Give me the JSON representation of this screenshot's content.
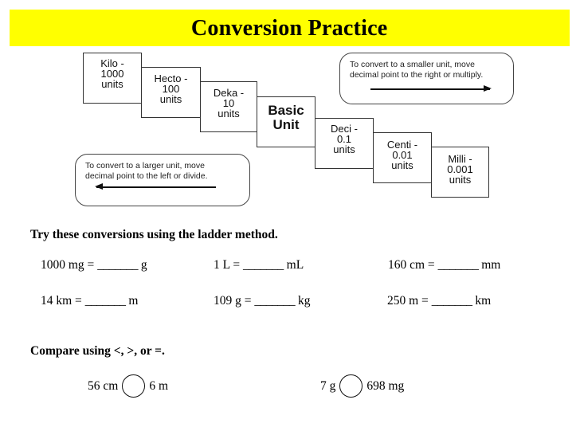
{
  "title": "Conversion Practice",
  "ladder": [
    {
      "prefix": "Kilo -",
      "value": "1000",
      "unit": "units"
    },
    {
      "prefix": "Hecto -",
      "value": "100",
      "unit": "units"
    },
    {
      "prefix": "Deka -",
      "value": "10",
      "unit": "units"
    },
    {
      "prefix": "Basic",
      "value": "Unit",
      "unit": ""
    },
    {
      "prefix": "Deci -",
      "value": "0.1",
      "unit": "units"
    },
    {
      "prefix": "Centi -",
      "value": "0.01",
      "unit": "units"
    },
    {
      "prefix": "Milli -",
      "value": "0.001",
      "unit": "units"
    }
  ],
  "notes": {
    "smaller": {
      "line1": "To convert to a smaller unit, move",
      "line2": "decimal  point to the right or multiply.",
      "arrow_direction": "right"
    },
    "larger": {
      "line1": "To convert to a larger unit, move",
      "line2": "decimal  point to the left or divide.",
      "arrow_direction": "left"
    }
  },
  "conversions": {
    "heading": "Try these conversions using the ladder method.",
    "problems": [
      {
        "left": "1000 mg =",
        "blank": "_______",
        "unit": "g"
      },
      {
        "left": "1 L =",
        "blank": "_______",
        "unit": "mL"
      },
      {
        "left": "160 cm =",
        "blank": "_______",
        "unit": "mm"
      },
      {
        "left": "14 km =",
        "blank": "_______",
        "unit": "m"
      },
      {
        "left": "109 g =",
        "blank": "_______",
        "unit": "kg"
      },
      {
        "left": "250 m =",
        "blank": "_______",
        "unit": "km"
      }
    ]
  },
  "compare": {
    "heading": "Compare using <, >, or =.",
    "items": [
      {
        "left": "56 cm",
        "right": "6 m"
      },
      {
        "left": "7 g",
        "right": "698 mg"
      }
    ]
  },
  "colors": {
    "banner": "#ffff00"
  }
}
